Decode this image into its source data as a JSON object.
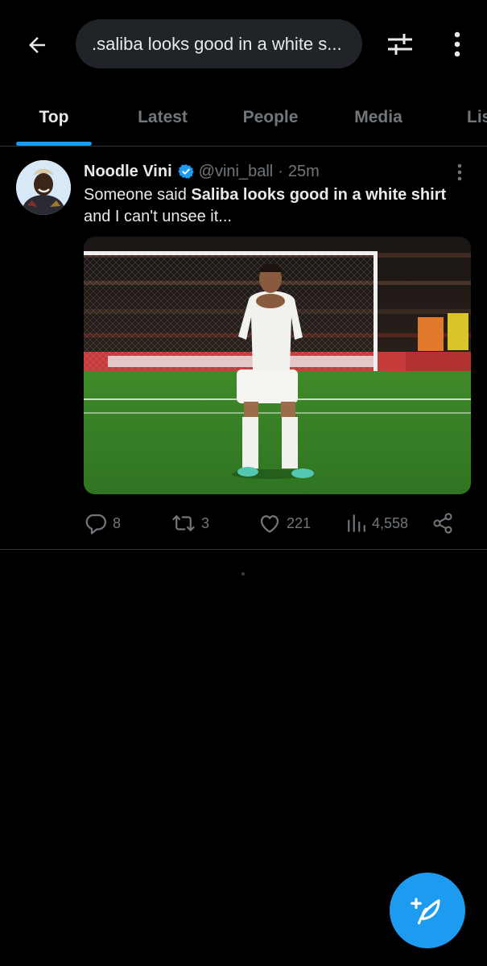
{
  "header": {
    "search_query": ".saliba looks good in a white s...",
    "back_icon": "arrow-left-icon",
    "filter_icon": "sliders-icon",
    "more_icon": "vertical-dots-icon"
  },
  "tabs": [
    {
      "label": "Top",
      "active": true
    },
    {
      "label": "Latest",
      "active": false
    },
    {
      "label": "People",
      "active": false
    },
    {
      "label": "Media",
      "active": false
    },
    {
      "label": "Lis",
      "active": false
    }
  ],
  "tweet": {
    "author_name": "Noodle Vini",
    "handle": "@vini_ball",
    "separator": "·",
    "time": "25m",
    "verified": true,
    "text_prefix": "Someone said ",
    "text_highlight": "Saliba looks good in a white shirt",
    "text_suffix": "and I can't unsee it...",
    "stats": {
      "replies": "8",
      "retweets": "3",
      "likes": "221",
      "views": "4,558"
    }
  },
  "colors": {
    "accent": "#1d9bf0",
    "background": "#000000",
    "muted": "#71767b",
    "text": "#e7e9ea"
  }
}
